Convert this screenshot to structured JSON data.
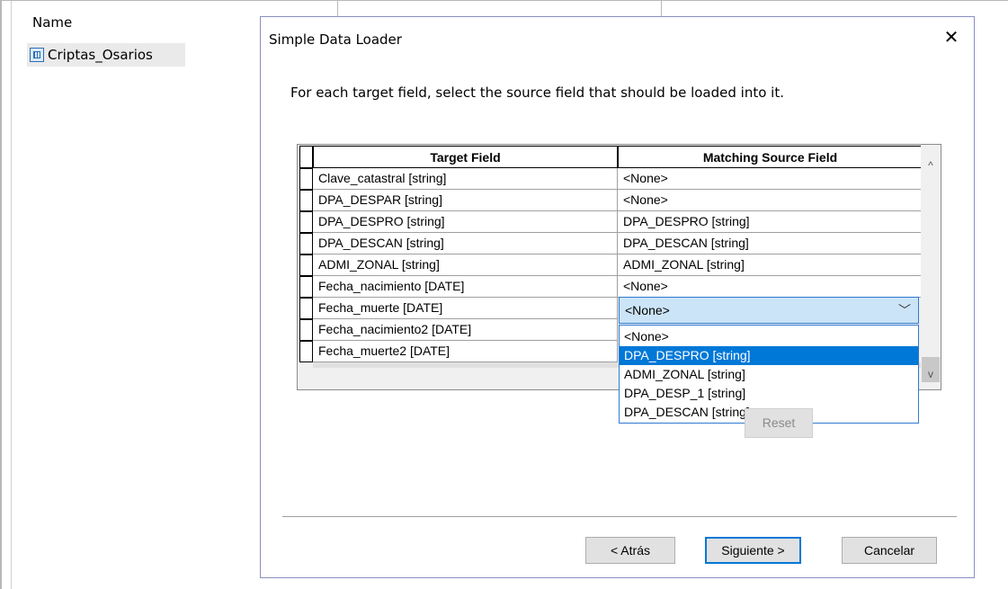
{
  "background": {
    "name_header": "Name",
    "item_label": "Criptas_Osarios",
    "item_icon": "feature-class-icon"
  },
  "dialog": {
    "title": "Simple Data Loader",
    "close_glyph": "✕",
    "instruction": "For each target field, select the source field that should be loaded into it.",
    "grid": {
      "headers": [
        "Target Field",
        "Matching Source Field"
      ],
      "rows": [
        {
          "target": "Clave_catastral [string]",
          "source": "<None>"
        },
        {
          "target": "DPA_DESPAR [string]",
          "source": "<None>"
        },
        {
          "target": "DPA_DESPRO [string]",
          "source": "DPA_DESPRO [string]"
        },
        {
          "target": "DPA_DESCAN [string]",
          "source": "DPA_DESCAN [string]"
        },
        {
          "target": "ADMI_ZONAL [string]",
          "source": "ADMI_ZONAL [string]"
        },
        {
          "target": "Fecha_nacimiento [DATE]",
          "source": "<None>"
        },
        {
          "target": "Fecha_muerte [DATE]",
          "source": ""
        },
        {
          "target": "Fecha_nacimiento2 [DATE]",
          "source": ""
        },
        {
          "target": "Fecha_muerte2 [DATE]",
          "source": ""
        }
      ]
    },
    "combo": {
      "value": "<None>",
      "arrow": "﹀"
    },
    "dropdown_options": [
      "<None>",
      "DPA_DESPRO [string]",
      "ADMI_ZONAL [string]",
      "DPA_DESP_1 [string]",
      "DPA_DESCAN [string]"
    ],
    "selected_option_index": 1,
    "reset_label": "Reset",
    "back_label": "< Atrás",
    "next_label": "Siguiente >",
    "cancel_label": "Cancelar",
    "scroll_up": "^",
    "scroll_down": "v"
  },
  "colors": {
    "accent": "#0078d7",
    "dialog_border": "#8a8fc0",
    "combo_bg": "#cce4f7"
  }
}
